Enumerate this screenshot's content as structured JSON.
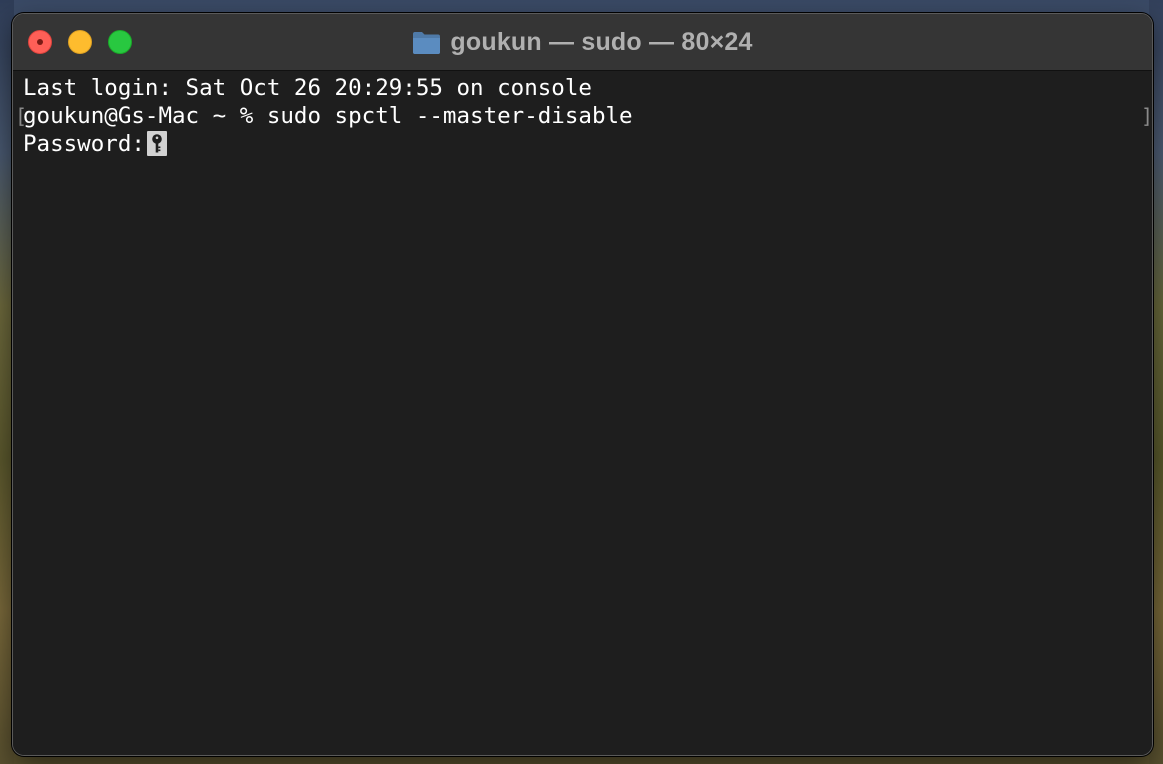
{
  "window": {
    "title": "goukun — sudo — 80×24",
    "title_icon": "folder-icon"
  },
  "traffic_lights": {
    "close_color": "#ff5f57",
    "minimize_color": "#febc2e",
    "maximize_color": "#28c840"
  },
  "terminal": {
    "background": "#1e1e1e",
    "text_color": "#ffffff",
    "lines": [
      "Last login: Sat Oct 26 20:29:55 on console",
      "goukun@Gs-Mac ~ % sudo spctl --master-disable",
      "Password:"
    ],
    "cursor_icon": "key-icon"
  }
}
